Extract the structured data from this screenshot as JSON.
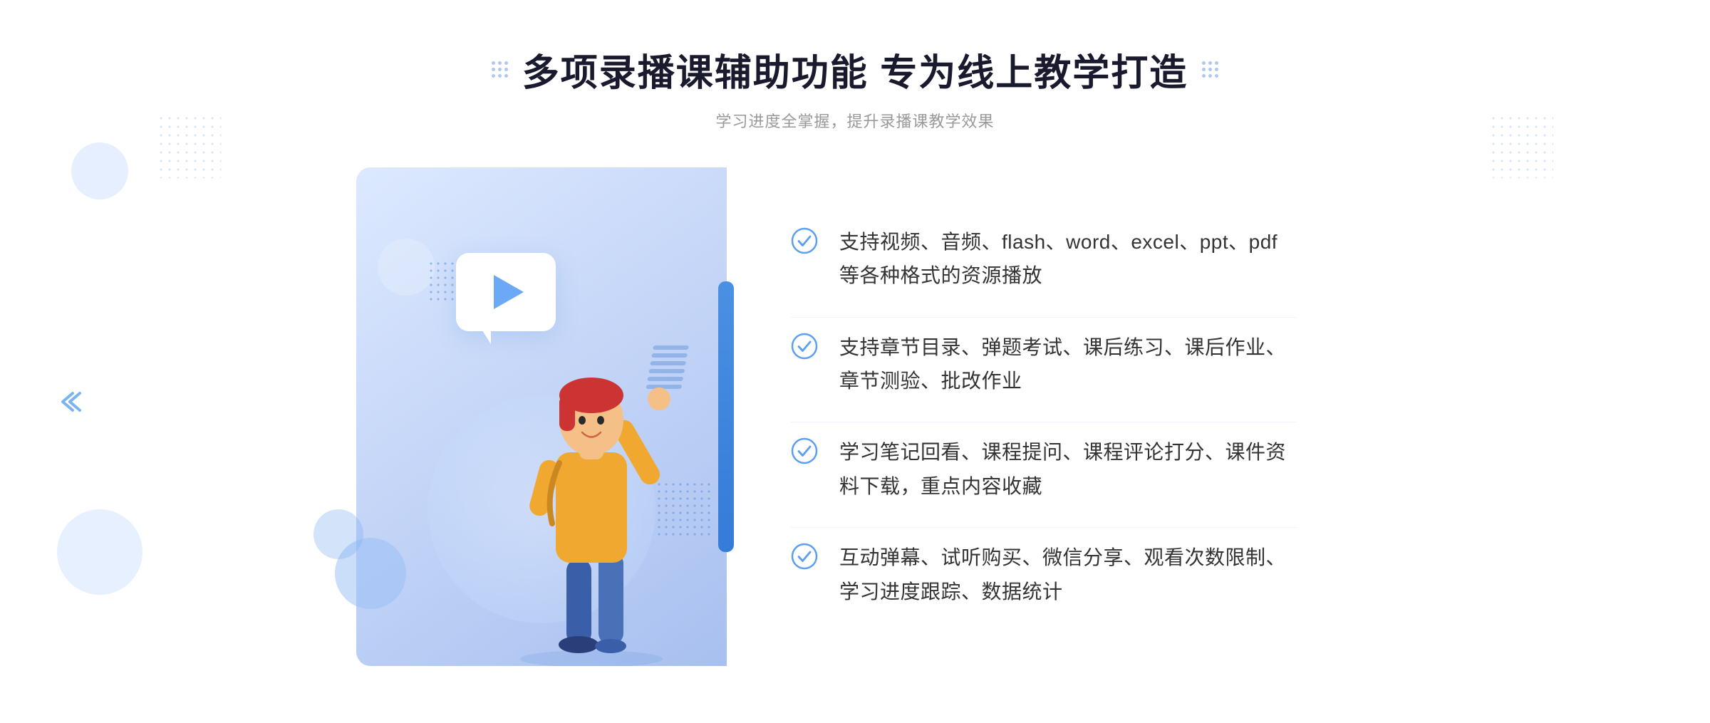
{
  "page": {
    "background": "#ffffff"
  },
  "header": {
    "title": "多项录播课辅助功能 专为线上教学打造",
    "subtitle": "学习进度全掌握，提升录播课教学效果",
    "dots_left_label": "dots-decoration-left",
    "dots_right_label": "dots-decoration-right"
  },
  "features": [
    {
      "id": 1,
      "text": "支持视频、音频、flash、word、excel、ppt、pdf等各种格式的资源播放"
    },
    {
      "id": 2,
      "text": "支持章节目录、弹题考试、课后练习、课后作业、章节测验、批改作业"
    },
    {
      "id": 3,
      "text": "学习笔记回看、课程提问、课程评论打分、课件资料下载，重点内容收藏"
    },
    {
      "id": 4,
      "text": "互动弹幕、试听购买、微信分享、观看次数限制、学习进度跟踪、数据统计"
    }
  ],
  "illustration": {
    "play_button_label": "播放",
    "alt": "线上教学插图"
  },
  "colors": {
    "primary_blue": "#4a90e2",
    "light_blue_bg": "#dce9ff",
    "check_color": "#5b9ef5",
    "title_color": "#1a1a2e",
    "text_color": "#333333",
    "subtitle_color": "#999999"
  },
  "navigation": {
    "left_arrow": "»",
    "right_arrow": "«"
  }
}
